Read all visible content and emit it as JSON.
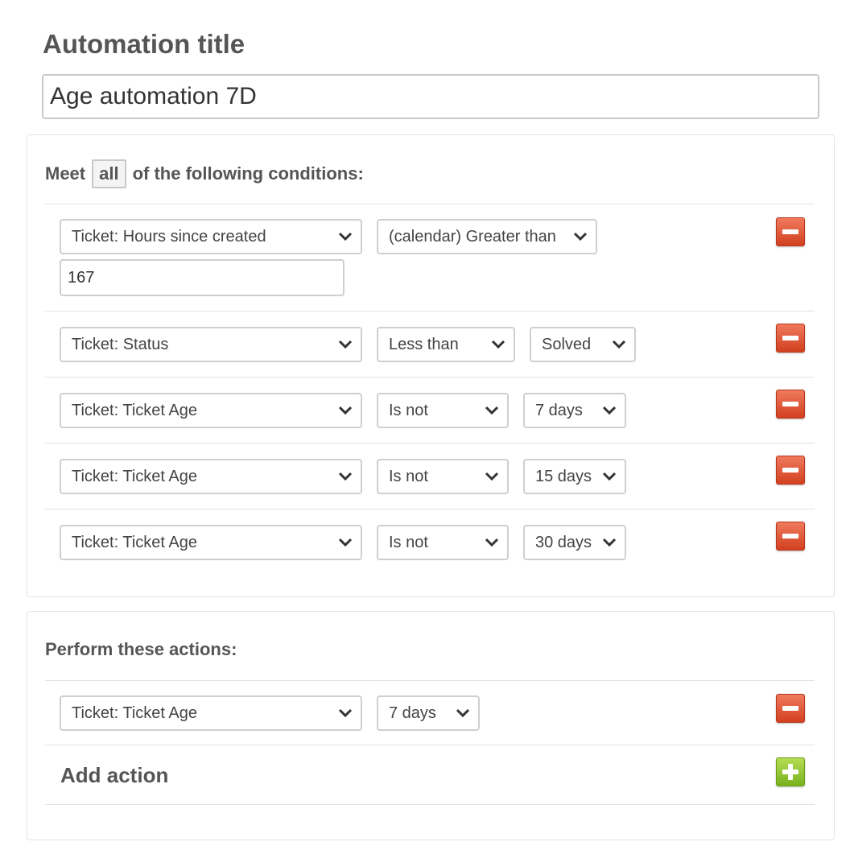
{
  "automation": {
    "title_label": "Automation title",
    "title_value": "Age automation 7D"
  },
  "conditions": {
    "meet_prefix": "Meet",
    "match_mode": "all",
    "meet_suffix": "of the following conditions:",
    "rows": [
      {
        "field": "Ticket: Hours since created",
        "operator": "(calendar) Greater than",
        "value": "167"
      },
      {
        "field": "Ticket: Status",
        "operator": "Less than",
        "value": "Solved"
      },
      {
        "field": "Ticket: Ticket Age",
        "operator": "Is not",
        "value": "7 days"
      },
      {
        "field": "Ticket: Ticket Age",
        "operator": "Is not",
        "value": "15 days"
      },
      {
        "field": "Ticket: Ticket Age",
        "operator": "Is not",
        "value": "30 days"
      }
    ]
  },
  "actions": {
    "heading": "Perform these actions:",
    "rows": [
      {
        "field": "Ticket: Ticket Age",
        "value": "7 days"
      }
    ],
    "add_label": "Add action"
  },
  "icons": {
    "remove": "minus-icon",
    "add": "plus-icon",
    "dropdown": "chevron-down-icon"
  },
  "colors": {
    "remove_button": "#d9482a",
    "add_button": "#8cc22a",
    "text": "#555555"
  }
}
